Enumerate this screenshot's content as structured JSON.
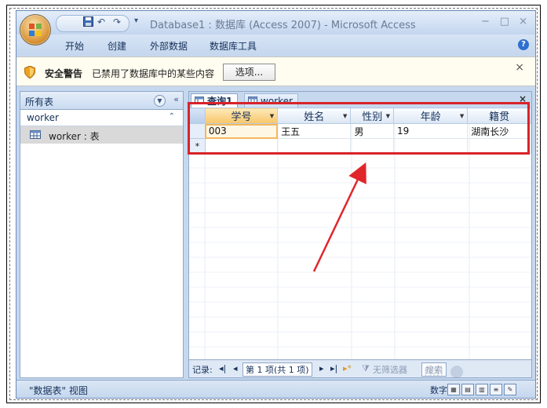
{
  "app": {
    "title": "Database1 : 数据库 (Access 2007) - Microsoft Access",
    "qat_undo": "↶",
    "qat_redo": "↷",
    "window_controls": [
      "−",
      "□",
      "×"
    ]
  },
  "ribbon": {
    "tabs": [
      "开始",
      "创建",
      "外部数据",
      "数据库工具"
    ],
    "help": "?"
  },
  "security_bar": {
    "title": "安全警告",
    "message": "已禁用了数据库中的某些内容",
    "options_label": "选项...",
    "close": "×"
  },
  "nav_pane": {
    "header": "所有表",
    "group": "worker",
    "items": [
      {
        "label": "worker : 表"
      }
    ]
  },
  "doc_tabs": [
    {
      "label": "查询1",
      "active": true
    },
    {
      "label": "worker",
      "active": false
    }
  ],
  "doc_close": "×",
  "datasheet": {
    "columns": [
      "学号",
      "姓名",
      "性别",
      "年龄",
      "籍贯"
    ],
    "rows": [
      [
        "003",
        "王五",
        "男",
        "19",
        "湖南长沙"
      ]
    ],
    "new_row_marker": "*"
  },
  "record_nav": {
    "label": "记录:",
    "position": "第 1 项(共 1 项)",
    "filter": "无筛选器",
    "search": "搜索"
  },
  "status_bar": {
    "view": "\"数据表\" 视图",
    "mode": "数字"
  },
  "colors": {
    "highlight_box": "#d8232a",
    "arrow": "#e0262b",
    "ribbon_bg": "#c6d8ee"
  }
}
